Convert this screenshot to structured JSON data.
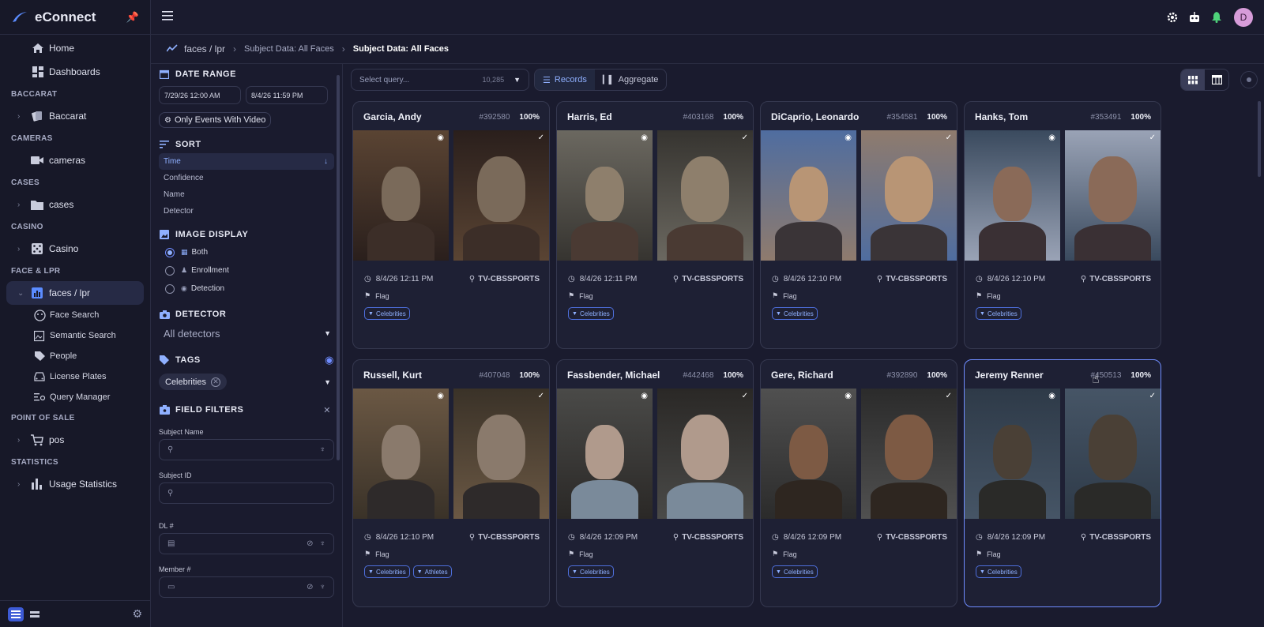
{
  "app": {
    "title": "eConnect",
    "avatar_initial": "D"
  },
  "sidebar": {
    "top": [
      {
        "label": "Home"
      },
      {
        "label": "Dashboards"
      }
    ],
    "sections": [
      {
        "title": "BACCARAT",
        "item": "Baccarat"
      },
      {
        "title": "CAMERAS",
        "item": "cameras"
      },
      {
        "title": "CASES",
        "item": "cases"
      },
      {
        "title": "CASINO",
        "item": "Casino"
      },
      {
        "title": "FACE & LPR",
        "item": "faces / lpr"
      },
      {
        "title": "POINT OF SALE",
        "item": "pos"
      },
      {
        "title": "STATISTICS",
        "item": "Usage Statistics"
      }
    ],
    "face_sub": [
      "Face Search",
      "Semantic Search",
      "People",
      "License Plates",
      "Query Manager"
    ]
  },
  "breadcrumb": {
    "root": "faces / lpr",
    "mid": "Subject Data: All Faces",
    "current": "Subject Data: All Faces"
  },
  "filters": {
    "date_range": {
      "title": "DATE RANGE",
      "start": "7/29/26 12:00 AM",
      "end": "8/4/26 11:59 PM",
      "video_toggle": "Only Events With Video"
    },
    "sort": {
      "title": "SORT",
      "options": [
        "Time",
        "Confidence",
        "Name",
        "Detector"
      ],
      "selected": "Time"
    },
    "image_display": {
      "title": "IMAGE DISPLAY",
      "options": [
        "Both",
        "Enrollment",
        "Detection"
      ],
      "selected": "Both"
    },
    "detector": {
      "title": "DETECTOR",
      "value": "All detectors"
    },
    "tags": {
      "title": "TAGS",
      "chips": [
        "Celebrities"
      ]
    },
    "field_filters": {
      "title": "FIELD FILTERS",
      "fields": [
        "Subject Name",
        "Subject ID",
        "DL #",
        "Member #"
      ]
    }
  },
  "toolbar": {
    "query_placeholder": "Select query...",
    "query_count": "10,285",
    "records_label": "Records",
    "aggregate_label": "Aggregate"
  },
  "cards": [
    {
      "name": "Garcia, Andy",
      "id": "#392580",
      "conf": "100%",
      "time": "8/4/26 12:11 PM",
      "source": "TV-CBSSPORTS",
      "flag": "Flag",
      "tags": [
        "Celebrities"
      ]
    },
    {
      "name": "Harris, Ed",
      "id": "#403168",
      "conf": "100%",
      "time": "8/4/26 12:11 PM",
      "source": "TV-CBSSPORTS",
      "flag": "Flag",
      "tags": [
        "Celebrities"
      ]
    },
    {
      "name": "DiCaprio, Leonardo",
      "id": "#354581",
      "conf": "100%",
      "time": "8/4/26 12:10 PM",
      "source": "TV-CBSSPORTS",
      "flag": "Flag",
      "tags": [
        "Celebrities"
      ]
    },
    {
      "name": "Hanks, Tom",
      "id": "#353491",
      "conf": "100%",
      "time": "8/4/26 12:10 PM",
      "source": "TV-CBSSPORTS",
      "flag": "Flag",
      "tags": [
        "Celebrities"
      ]
    },
    {
      "name": "Russell, Kurt",
      "id": "#407048",
      "conf": "100%",
      "time": "8/4/26 12:10 PM",
      "source": "TV-CBSSPORTS",
      "flag": "Flag",
      "tags": [
        "Celebrities",
        "Athletes"
      ]
    },
    {
      "name": "Fassbender, Michael",
      "id": "#442468",
      "conf": "100%",
      "time": "8/4/26 12:09 PM",
      "source": "TV-CBSSPORTS",
      "flag": "Flag",
      "tags": [
        "Celebrities"
      ]
    },
    {
      "name": "Gere, Richard",
      "id": "#392890",
      "conf": "100%",
      "time": "8/4/26 12:09 PM",
      "source": "TV-CBSSPORTS",
      "flag": "Flag",
      "tags": [
        "Celebrities"
      ]
    },
    {
      "name": "Jeremy Renner",
      "id": "#450513",
      "conf": "100%",
      "time": "8/4/26 12:09 PM",
      "source": "TV-CBSSPORTS",
      "flag": "Flag",
      "tags": [
        "Celebrities"
      ]
    }
  ],
  "colors": {
    "accent": "#8fb0ff",
    "bg": "#1a1b2e",
    "card": "#1e2034",
    "highlight": "#6f8cff"
  }
}
